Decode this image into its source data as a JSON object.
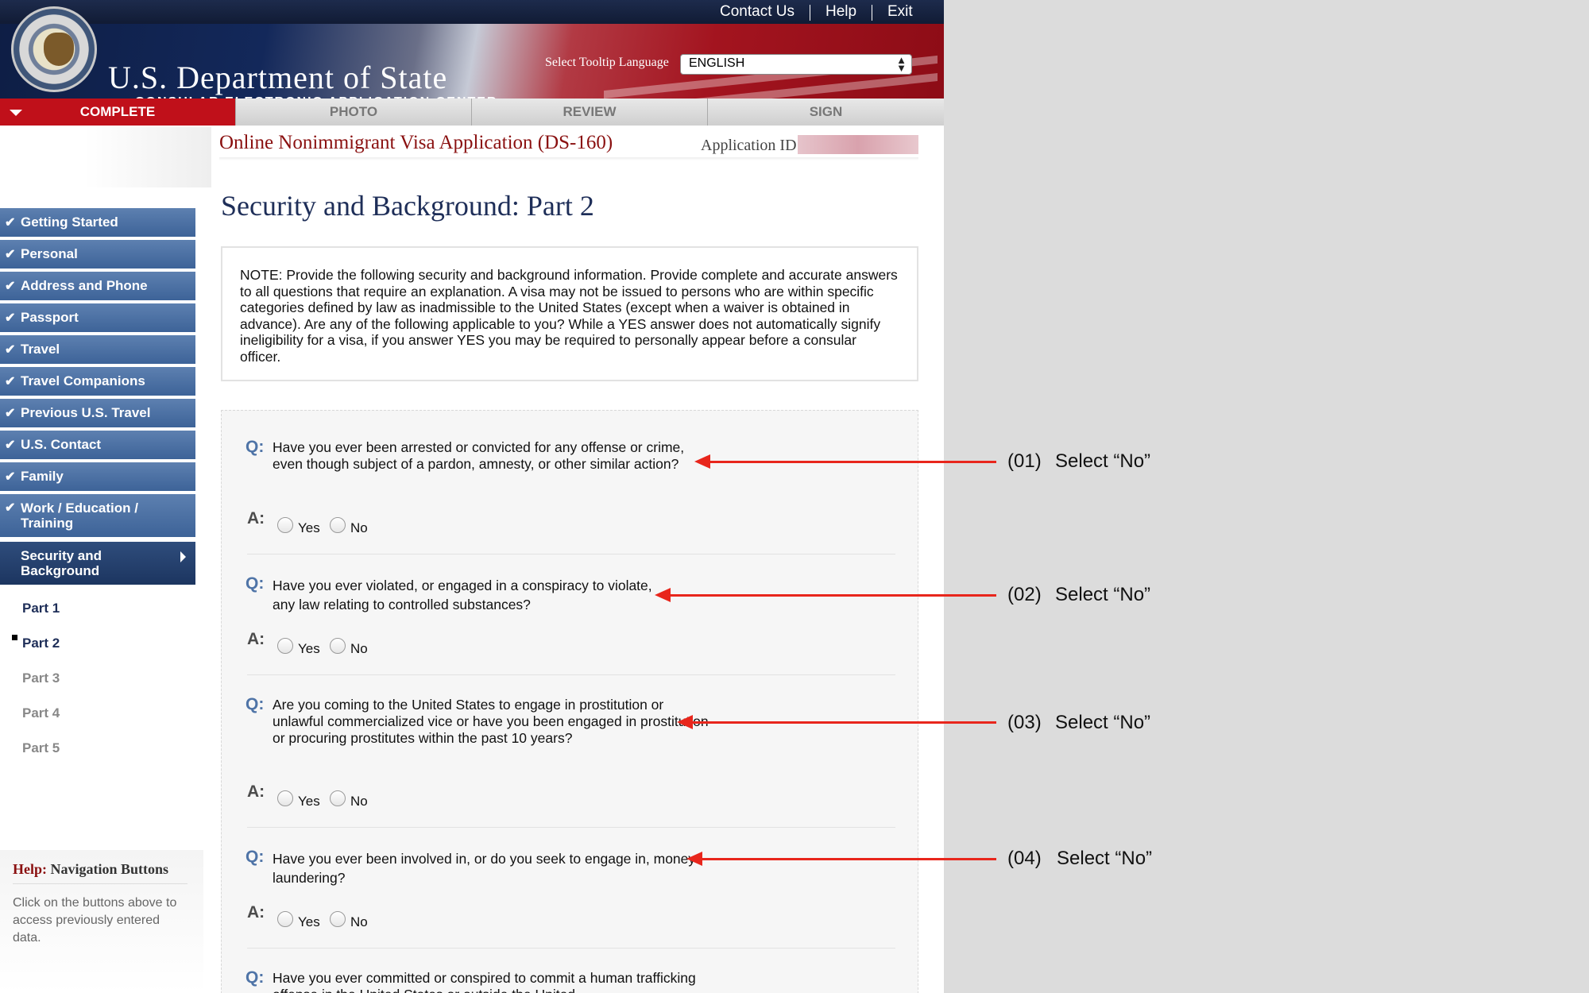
{
  "header": {
    "links": [
      "Contact Us",
      "Help",
      "Exit"
    ],
    "dept_title": "U.S. Department of State",
    "dept_subtitle": "CONSULAR ELECTRONIC APPLICATION CENTER",
    "tooltip_label": "Select Tooltip Language",
    "language": "ENGLISH"
  },
  "tabs": [
    "COMPLETE",
    "PHOTO",
    "REVIEW",
    "SIGN"
  ],
  "active_tab": "COMPLETE",
  "form": {
    "title": "Online Nonimmigrant Visa Application (DS-160)",
    "app_id_label": "Application ID"
  },
  "sidebar": {
    "items": [
      "Getting Started",
      "Personal",
      "Address and Phone",
      "Passport",
      "Travel",
      "Travel Companions",
      "Previous U.S. Travel",
      "U.S. Contact",
      "Family",
      "Work / Education / Training",
      "Security and Background"
    ],
    "subitems": [
      "Part 1",
      "Part 2",
      "Part 3",
      "Part 4",
      "Part 5"
    ],
    "current_subitem": "Part 2",
    "help_title_prefix": "Help:",
    "help_title": "Navigation Buttons",
    "help_text": "Click on the buttons above to access previously entered data."
  },
  "page": {
    "title": "Security and Background: Part 2",
    "note": "NOTE: Provide the following security and background information. Provide complete and accurate answers to all questions that require an explanation. A visa may not be issued to persons who are within specific categories defined by law as inadmissible to the United States (except when a waiver is obtained in advance). Are any of the following applicable to you? While a YES answer does not automatically signify ineligibility for a visa, if you answer YES you may be required to personally appear before a consular officer.",
    "q_label": "Q:",
    "a_label": "A:",
    "yes_label": "Yes",
    "no_label": "No",
    "questions": [
      "Have you ever been arrested or convicted for any offense or crime, even though subject of a pardon, amnesty, or other similar action?",
      "Have you ever violated, or engaged in a conspiracy to violate, any law relating to controlled substances?",
      "Are you coming to the United States to engage in prostitution or unlawful commercialized vice or have you been engaged in prostitution or procuring prostitutes within the past 10 years?",
      "Have you ever been involved in, or do you seek to engage in, money laundering?",
      "Have you ever committed or conspired to commit a human trafficking offense in the United States or outside the United"
    ]
  },
  "annotations": [
    {
      "num": "(01)",
      "text": "Select “No”"
    },
    {
      "num": "(02)",
      "text": "Select “No”"
    },
    {
      "num": "(03)",
      "text": "Select “No”"
    },
    {
      "num": "(04)",
      "text": "Select “No”"
    }
  ],
  "colors": {
    "accent_red": "#c0101a",
    "nav_blue": "#4a6fa5",
    "q_blue": "#4f74a7",
    "annotation_red": "#e8261c"
  }
}
